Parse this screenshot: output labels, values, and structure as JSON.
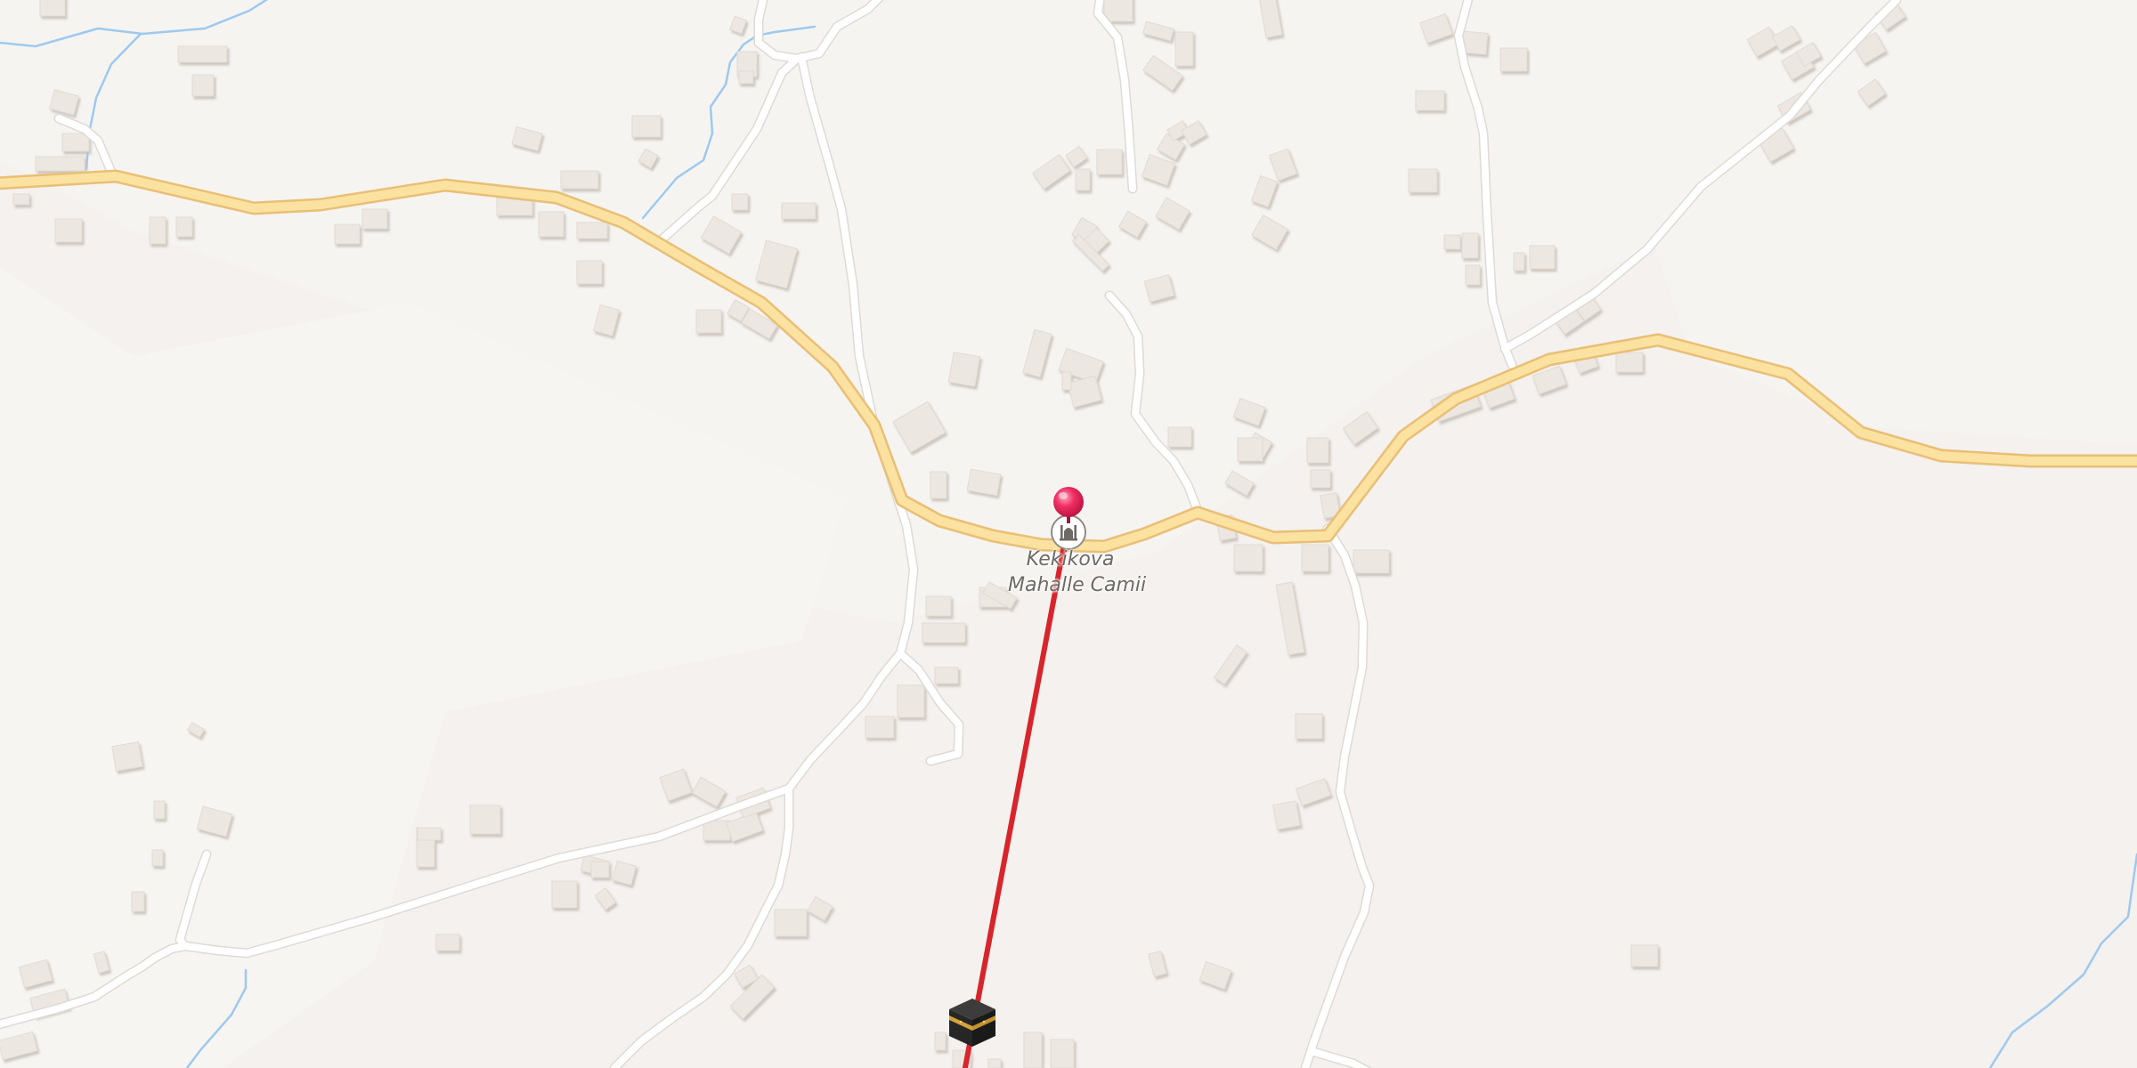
{
  "map": {
    "poi": {
      "name_line1": "Kekikova",
      "name_line2": "Mahalle Camii",
      "icon": "mosque-icon"
    },
    "marker": {
      "icon": "map-pin-icon",
      "color": "#e8245a"
    },
    "qibla": {
      "icon": "kaaba-icon",
      "line_color": "#d8242b"
    },
    "colors": {
      "background": "#f4f1ee",
      "main_road": "#fbe2a0",
      "main_road_casing": "#e9bf76",
      "minor_road": "#ffffff",
      "minor_road_casing": "#dedad6",
      "water": "#9ec9ef",
      "building": "#ece7e1"
    }
  }
}
